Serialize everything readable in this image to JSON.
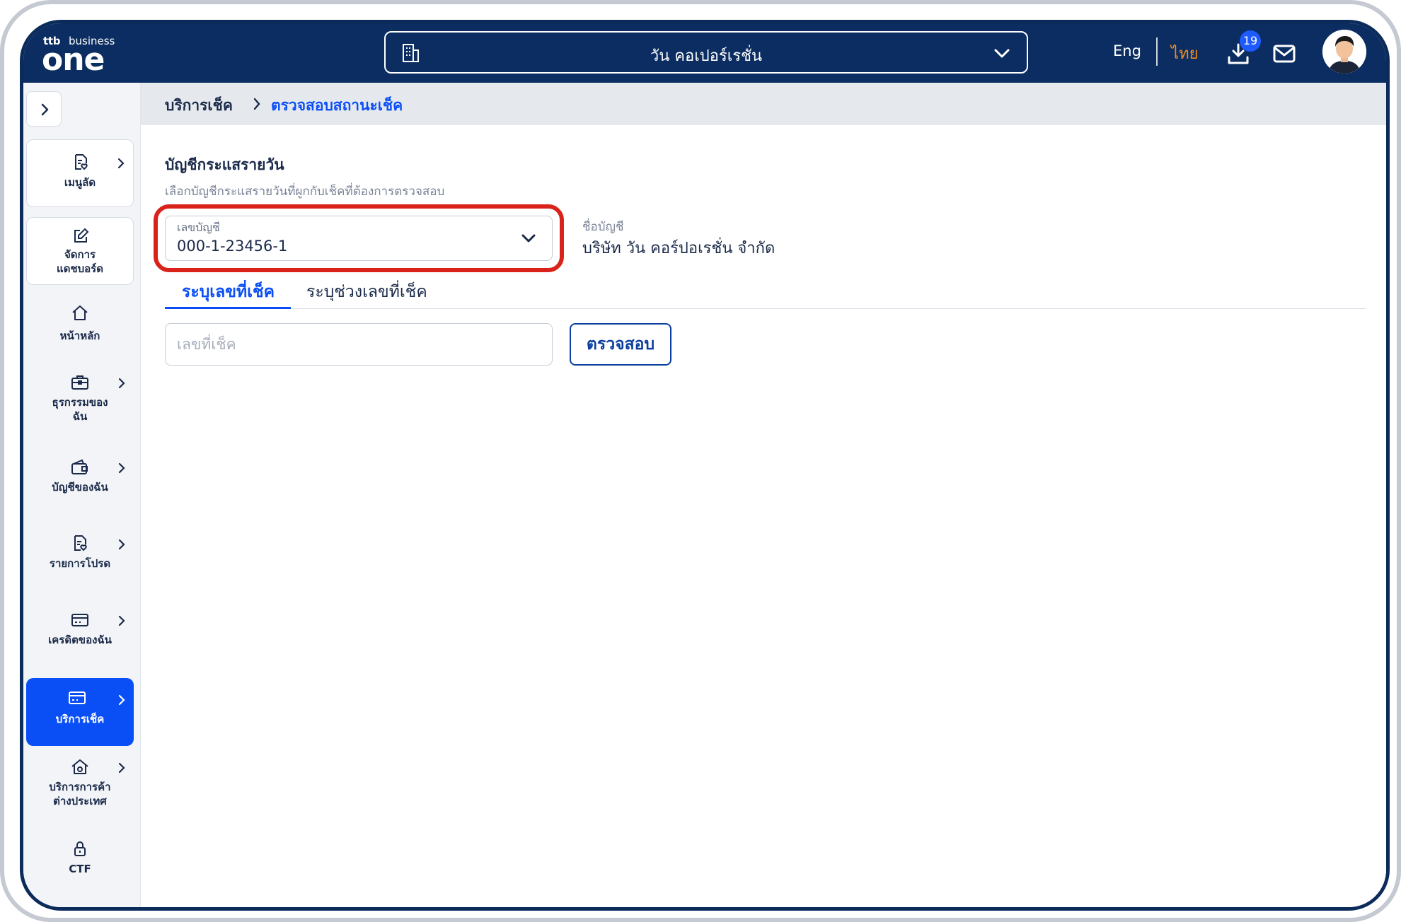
{
  "app": {
    "logo_tag": "ttb",
    "logo_sub": "business",
    "logo_word": "one"
  },
  "topbar": {
    "company_name": "วัน คอเปอร์เรชั่น",
    "lang_eng": "Eng",
    "lang_thai": "ไทย",
    "download_count": "19",
    "accent_color": "#0b2d61",
    "active_lang_color": "#f08c1e"
  },
  "sidebar": {
    "items": [
      {
        "label_lines": [
          "เมนูลัด"
        ],
        "icon": "doc-heart-icon",
        "has_arrow": true
      },
      {
        "label_lines": [
          "จัดการ",
          "แดชบอร์ด"
        ],
        "icon": "edit-icon",
        "has_arrow": false
      },
      {
        "label_lines": [
          "หน้าหลัก"
        ],
        "icon": "home-icon",
        "has_arrow": false
      },
      {
        "label_lines": [
          "ธุรกรรมของ",
          "ฉัน"
        ],
        "icon": "briefcase-icon",
        "has_arrow": true
      },
      {
        "label_lines": [
          "บัญชีของฉัน"
        ],
        "icon": "wallet-icon",
        "has_arrow": true
      },
      {
        "label_lines": [
          "รายการโปรด"
        ],
        "icon": "doc-heart-icon",
        "has_arrow": true
      },
      {
        "label_lines": [
          "เครดิตของฉัน"
        ],
        "icon": "credit-card-icon",
        "has_arrow": true
      },
      {
        "label_lines": [
          "บริการเช็ค"
        ],
        "icon": "cheque-icon",
        "has_arrow": true
      },
      {
        "label_lines": [
          "บริการการค้า",
          "ต่างประเทศ"
        ],
        "icon": "trade-house-icon",
        "has_arrow": true
      },
      {
        "label_lines": [
          "CTF"
        ],
        "icon": "lock-icon",
        "has_arrow": false
      }
    ]
  },
  "breadcrumb": {
    "parent": "บริการเช็ค",
    "current": "ตรวจสอบสถานะเช็ค"
  },
  "form": {
    "section_title": "บัญชีกระแสรายวัน",
    "section_subtitle": "เลือกบัญชีกระแสรายวันที่ผูกกับเช็คที่ต้องการตรวจสอบ",
    "account_label": "เลขบัญชี",
    "account_value": "000-1-23456-1",
    "account_name_label": "ชื่อบัญชี",
    "account_name_value": "บริษัท วัน คอร์ปอเรชั่น จำกัด",
    "tabs": [
      "ระบุเลขที่เช็ค",
      "ระบุช่วงเลขที่เช็ค"
    ],
    "cheque_placeholder": "เลขที่เช็ค",
    "check_button": "ตรวจสอบ",
    "highlight_color": "#d9231a",
    "primary_color": "#0a4ef5"
  }
}
